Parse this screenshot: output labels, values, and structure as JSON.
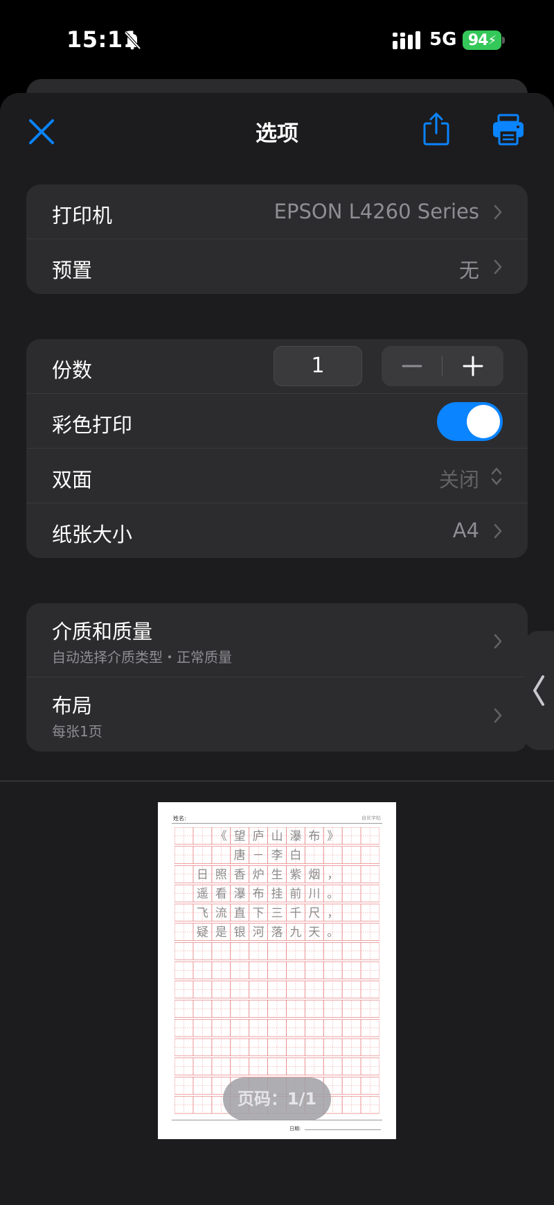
{
  "status_bar": {
    "time": "15:11",
    "network": "5G",
    "battery": "94"
  },
  "nav": {
    "title": "选项"
  },
  "printer_group": {
    "printer_label": "打印机",
    "printer_value": "EPSON L4260 Series",
    "preset_label": "预置",
    "preset_value": "无"
  },
  "options_group": {
    "copies_label": "份数",
    "copies_value": "1",
    "color_label": "彩色打印",
    "color_on": true,
    "duplex_label": "双面",
    "duplex_value": "关闭",
    "paper_label": "纸张大小",
    "paper_value": "A4"
  },
  "media_group": {
    "media_label": "介质和质量",
    "media_sub": "自动选择介质类型・正常质量",
    "layout_label": "布局",
    "layout_sub": "每张1页"
  },
  "preview": {
    "name_label": "姓名:",
    "brand": "自优字帖",
    "date_label": "日期:",
    "grid_lines": [
      "《望庐山瀑布》",
      "唐－李白",
      "日照香炉生紫烟，",
      "遥看瀑布挂前川。",
      "飞流直下三千尺，",
      "疑是银河落九天。"
    ],
    "page_indicator": "页码：1/1"
  },
  "colors": {
    "accent": "#0a84ff",
    "battery": "#34c759",
    "grid": "#e88a8a"
  }
}
